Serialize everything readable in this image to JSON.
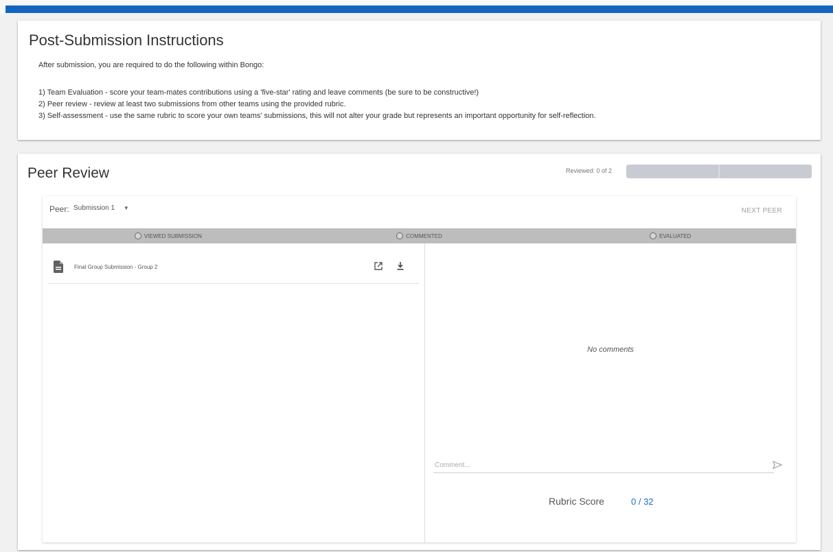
{
  "instructions": {
    "title": "Post-Submission Instructions",
    "intro": "After submission, you are required to do the following within Bongo:",
    "steps": [
      "1) Team Evaluation - score your team-mates contributions using a 'five-star' rating and leave comments (be sure to be constructive!)",
      "2) Peer review - review at least two submissions from other teams using the provided rubric.",
      "3) Self-assessment - use the same rubric to score your own teams' submissions, this will not alter your grade but represents an important opportunity for self-reflection."
    ]
  },
  "peer_review": {
    "title": "Peer Review",
    "reviewed_text": "Reviewed: 0 of 2",
    "reviewed_count": 0,
    "reviewed_total": 2,
    "peer_label": "Peer:",
    "peer_selected": "Submission 1",
    "next_peer_label": "NEXT PEER",
    "steps": [
      "VIEWED SUBMISSION",
      "COMMENTED",
      "EVALUATED"
    ],
    "file_name": "Final Group Submission - Group 2",
    "no_comments": "No comments",
    "comment_placeholder": "Comment...",
    "rubric_label": "Rubric Score",
    "rubric_value": "0 / 32"
  },
  "colors": {
    "accent": "#1565c0",
    "rubric_value": "#1e6fbd",
    "steps_bar": "#bdbdbd",
    "progress_track": "#c8ccd2"
  },
  "icons": [
    "document-icon",
    "open-external-icon",
    "download-icon",
    "send-icon",
    "dropdown-caret-icon",
    "radio-unchecked-icon"
  ]
}
